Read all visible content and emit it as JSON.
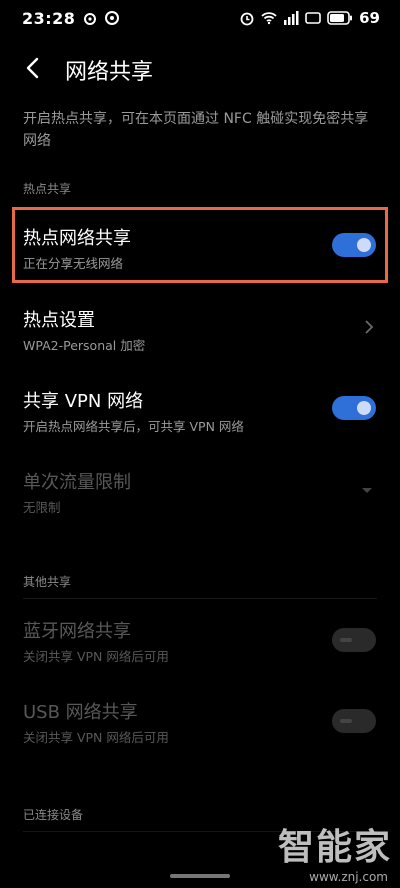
{
  "status_bar": {
    "time": "23:28",
    "battery": "69",
    "left_icons": [
      "weibo-icon",
      "hotspot-icon"
    ],
    "right_icons": [
      "alarm-icon",
      "wifi-icon",
      "signal-icon",
      "hd-icon",
      "battery-icon"
    ]
  },
  "header": {
    "back_icon": "chevron-left-icon",
    "title": "网络共享"
  },
  "description": "开启热点共享，可在本页面通过 NFC 触碰实现免密共享网络",
  "sections": {
    "hotspot": "热点共享",
    "other": "其他共享",
    "connected": "已连接设备"
  },
  "rows": {
    "hotspot_share": {
      "title": "热点网络共享",
      "subtitle": "正在分享无线网络",
      "toggle": "on"
    },
    "hotspot_settings": {
      "title": "热点设置",
      "subtitle": "WPA2-Personal 加密"
    },
    "vpn_share": {
      "title": "共享 VPN 网络",
      "subtitle": "开启热点网络共享后，可共享 VPN 网络",
      "toggle": "on"
    },
    "data_limit": {
      "title": "单次流量限制",
      "subtitle": "无限制"
    },
    "bluetooth_share": {
      "title": "蓝牙网络共享",
      "subtitle": "关闭共享 VPN 网络后可用",
      "toggle": "off"
    },
    "usb_share": {
      "title": "USB 网络共享",
      "subtitle": "关闭共享 VPN 网络后可用",
      "toggle": "off"
    }
  },
  "watermark": {
    "text": "智能家",
    "url": "www.znj.com"
  },
  "colors": {
    "accent": "#2e6fd8",
    "highlight": "#e8684a",
    "background": "#000000"
  }
}
